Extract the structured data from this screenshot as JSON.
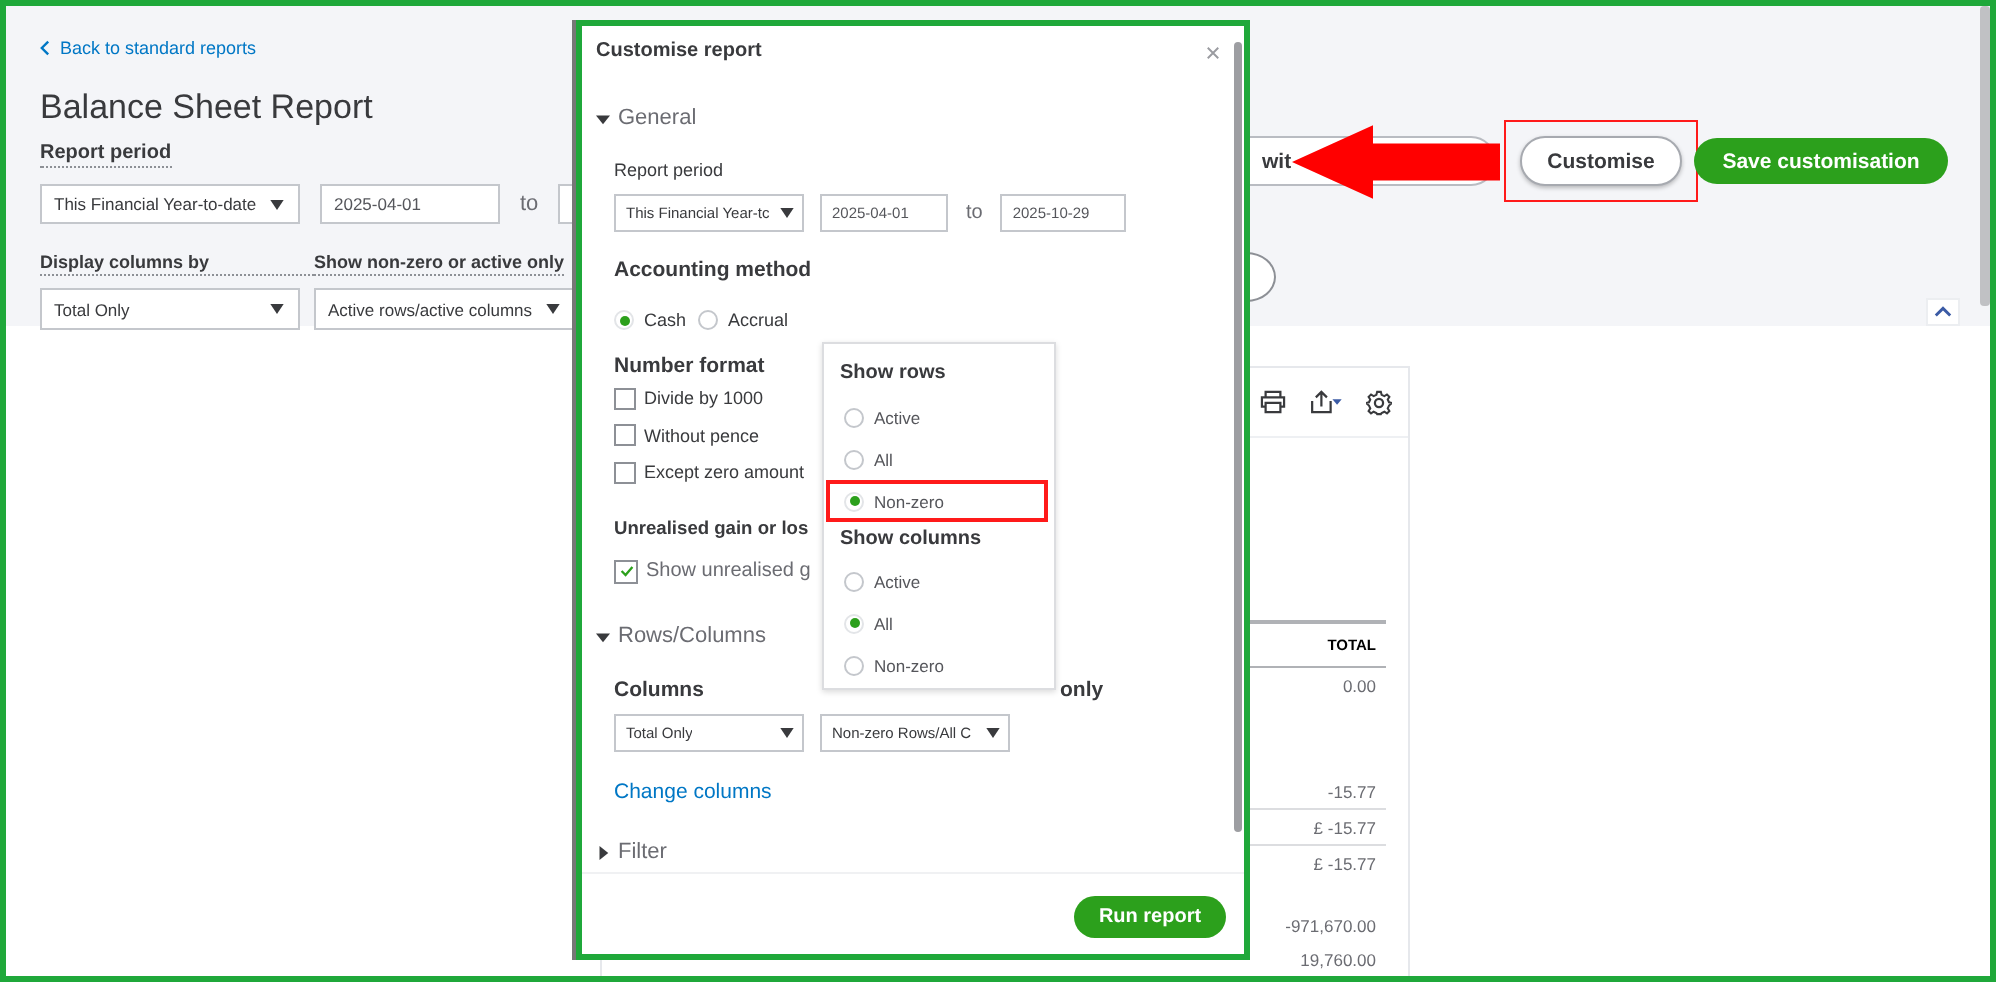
{
  "page": {
    "highlighted": true,
    "back_link": "Back to standard reports",
    "title": "Balance Sheet Report",
    "report_period_label": "Report period",
    "period_select": "This Financial Year-to-date",
    "start_date": "2025-04-01",
    "to_label": "to",
    "display_columns_label": "Display columns by",
    "display_columns_select": "Total Only",
    "show_nonzero_label": "Show non-zero or active only",
    "show_nonzero_select": "Active rows/active columns",
    "switch_button": "wit",
    "customise_button": {
      "label": "Customise",
      "highlighted": true,
      "arrow": true
    },
    "save_button": "Save customisation"
  },
  "report": {
    "column_header": "TOTAL",
    "values": [
      {
        "text": "0.00",
        "kind": "amount"
      },
      {
        "text": "-15.77",
        "kind": "group_first"
      },
      {
        "text": "£ -15.77",
        "kind": "subtotal"
      },
      {
        "text": "£ -15.77",
        "kind": "subtotal"
      },
      {
        "text": "-971,670.00",
        "kind": "group_first"
      },
      {
        "text": "19,760.00",
        "kind": "amount"
      }
    ]
  },
  "dialog": {
    "title": "Customise report",
    "highlighted": true,
    "general": {
      "label": "General",
      "expanded": true,
      "report_period_label": "Report period",
      "period_select": "This Financial Year-tc",
      "start_date": "2025-04-01",
      "to_label": "to",
      "end_date": "2025-10-29",
      "accounting_label": "Accounting method",
      "accounting_options": [
        {
          "label": "Cash",
          "selected": true
        },
        {
          "label": "Accrual",
          "selected": false
        }
      ],
      "number_format_label": "Number format",
      "number_options": [
        {
          "label": "Divide by 1000",
          "checked": false
        },
        {
          "label": "Without pence",
          "checked": false
        },
        {
          "label": "Except zero amount",
          "checked": false
        }
      ],
      "unrealised_label": "Unrealised gain or los",
      "unrealised_option": {
        "label": "Show unrealised g",
        "checked": true
      }
    },
    "rows_columns": {
      "label": "Rows/Columns",
      "expanded": true,
      "columns_label": "Columns",
      "show_label": "only",
      "columns_select": "Total Only",
      "show_select": "Non-zero Rows/All C",
      "change_columns_link": "Change columns"
    },
    "filter": {
      "label": "Filter",
      "expanded": false
    },
    "run_button": "Run report"
  },
  "dropdown": {
    "groups": [
      {
        "heading": "Show rows",
        "options": [
          {
            "label": "Active",
            "selected": false,
            "highlighted": false
          },
          {
            "label": "All",
            "selected": false,
            "highlighted": false
          },
          {
            "label": "Non-zero",
            "selected": true,
            "highlighted": true
          }
        ]
      },
      {
        "heading": "Show columns",
        "options": [
          {
            "label": "Active",
            "selected": false,
            "highlighted": false
          },
          {
            "label": "All",
            "selected": true,
            "highlighted": false
          },
          {
            "label": "Non-zero",
            "selected": false,
            "highlighted": false
          }
        ]
      }
    ]
  }
}
